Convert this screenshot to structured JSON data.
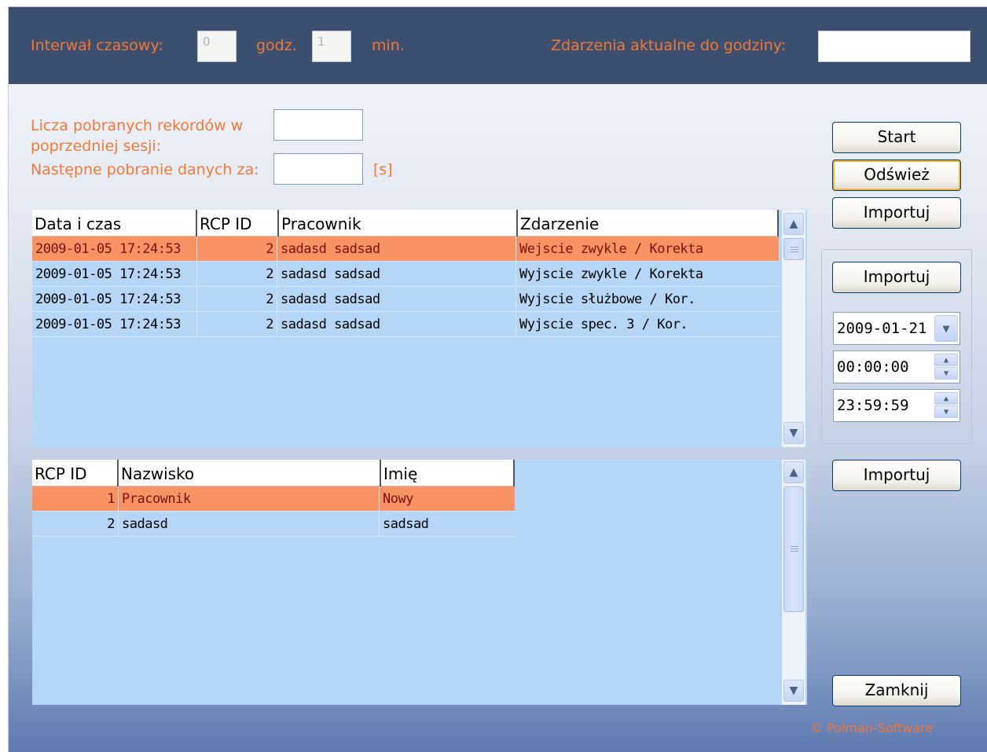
{
  "top": {
    "interval_label": "Interwał czasowy:",
    "hours_value": "0",
    "hours_unit": "godz.",
    "minutes_value": "1",
    "minutes_unit": "min.",
    "events_until_label": "Zdarzenia aktualne do godziny:",
    "events_until_value": ""
  },
  "session": {
    "records_label_line1": "Licza pobranych rekordów w",
    "records_label_line2": "poprzedniej sesji:",
    "records_value": "",
    "next_fetch_label": "Następne pobranie danych za:",
    "next_fetch_value": "",
    "next_fetch_unit": "[s]"
  },
  "events_table": {
    "columns": [
      "Data i czas",
      "RCP ID",
      "Pracownik",
      "Zdarzenie"
    ],
    "rows": [
      {
        "datetime": "2009-01-05  17:24:53",
        "rcp_id": "2",
        "employee": "sadasd sadsad",
        "event": "Wejscie zwykle / Korekta"
      },
      {
        "datetime": "2009-01-05  17:24:53",
        "rcp_id": "2",
        "employee": "sadasd sadsad",
        "event": "Wyjscie zwykle / Korekta"
      },
      {
        "datetime": "2009-01-05  17:24:53",
        "rcp_id": "2",
        "employee": "sadasd sadsad",
        "event": "Wyjscie służbowe / Kor."
      },
      {
        "datetime": "2009-01-05  17:24:53",
        "rcp_id": "2",
        "employee": "sadasd sadsad",
        "event": "Wyjscie spec. 3 / Kor."
      }
    ],
    "selected_row": 0
  },
  "employees_table": {
    "columns": [
      "RCP ID",
      "Nazwisko",
      "Imię"
    ],
    "rows": [
      {
        "rcp_id": "1",
        "surname": "Pracownik",
        "name": "Nowy"
      },
      {
        "rcp_id": "2",
        "surname": "sadasd",
        "name": "sadsad"
      }
    ],
    "selected_row": 0
  },
  "buttons": {
    "start": "Start",
    "refresh": "Odśwież",
    "import1": "Importuj",
    "import2": "Importuj",
    "import3": "Importuj",
    "close": "Zamknij"
  },
  "range": {
    "date": "2009-01-21",
    "time_from": "00:00:00",
    "time_to": "23:59:59"
  },
  "footer": {
    "copyright": "© Polman-Software"
  },
  "colors": {
    "accent_orange": "#f07838",
    "selected_row": "#f99363",
    "grid_background": "#b5d6f6",
    "top_bar": "#3c4f6e"
  }
}
